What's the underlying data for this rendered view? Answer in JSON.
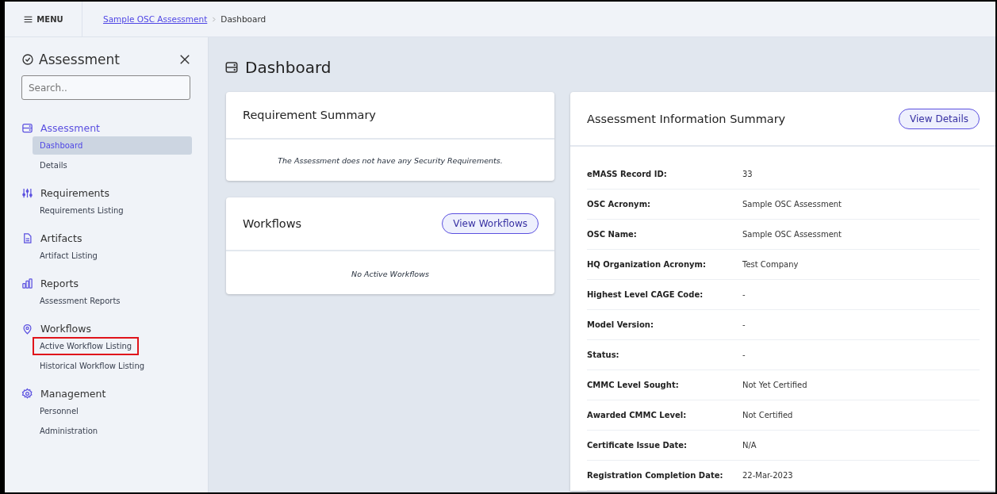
{
  "topbar": {
    "menu_label": "MENU",
    "breadcrumb": [
      {
        "label": "Sample OSC Assessment",
        "kind": "link"
      },
      {
        "label": "Dashboard",
        "kind": "current"
      }
    ]
  },
  "sidebar": {
    "title": "Assessment",
    "search": {
      "placeholder": "Search.."
    },
    "groups": [
      {
        "label": "Assessment",
        "active": true,
        "items": [
          {
            "label": "Dashboard",
            "selected": true,
            "highlighted": false
          },
          {
            "label": "Details",
            "selected": false,
            "highlighted": false
          }
        ]
      },
      {
        "label": "Requirements",
        "active": false,
        "items": [
          {
            "label": "Requirements Listing",
            "selected": false,
            "highlighted": false
          }
        ]
      },
      {
        "label": "Artifacts",
        "active": false,
        "items": [
          {
            "label": "Artifact Listing",
            "selected": false,
            "highlighted": false
          }
        ]
      },
      {
        "label": "Reports",
        "active": false,
        "items": [
          {
            "label": "Assessment Reports",
            "selected": false,
            "highlighted": false
          }
        ]
      },
      {
        "label": "Workflows",
        "active": false,
        "items": [
          {
            "label": "Active Workflow Listing",
            "selected": false,
            "highlighted": true
          },
          {
            "label": "Historical Workflow Listing",
            "selected": false,
            "highlighted": false
          }
        ]
      },
      {
        "label": "Management",
        "active": false,
        "items": [
          {
            "label": "Personnel",
            "selected": false,
            "highlighted": false
          },
          {
            "label": "Administration",
            "selected": false,
            "highlighted": false
          }
        ]
      }
    ]
  },
  "page_title": "Dashboard",
  "requirement_summary": {
    "title": "Requirement Summary",
    "message": "The Assessment does not have any Security Requirements."
  },
  "workflows": {
    "title": "Workflows",
    "button": "View Workflows",
    "message": "No Active Workflows"
  },
  "assessment_info": {
    "title": "Assessment Information Summary",
    "button": "View Details",
    "rows": [
      {
        "label": "eMASS Record ID:",
        "value": "33"
      },
      {
        "label": "OSC Acronym:",
        "value": "Sample OSC Assessment"
      },
      {
        "label": "OSC Name:",
        "value": "Sample OSC Assessment"
      },
      {
        "label": "HQ Organization Acronym:",
        "value": "Test Company"
      },
      {
        "label": "Highest Level CAGE Code:",
        "value": "-"
      },
      {
        "label": "Model Version:",
        "value": "-"
      },
      {
        "label": "Status:",
        "value": "-"
      },
      {
        "label": "CMMC Level Sought:",
        "value": "Not Yet Certified"
      },
      {
        "label": "Awarded CMMC Level:",
        "value": "Not Certified"
      },
      {
        "label": "Certificate Issue Date:",
        "value": "N/A"
      },
      {
        "label": "Registration Completion Date:",
        "value": "22-Mar-2023"
      }
    ]
  }
}
